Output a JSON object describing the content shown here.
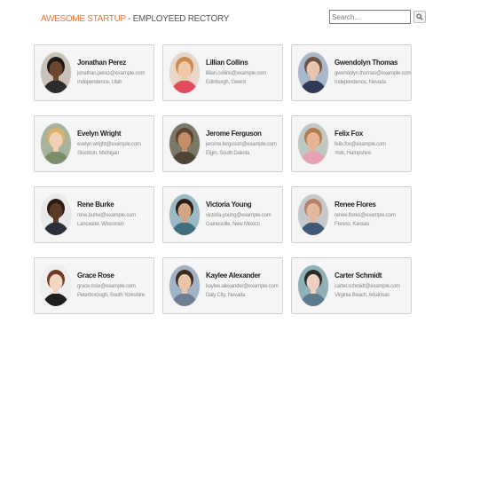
{
  "header": {
    "brand": "AWESOME STARTUP",
    "subtitle": " - EMPLOYEED RECTORY"
  },
  "search": {
    "placeholder": "Search...",
    "button_icon": "search-icon"
  },
  "employees": [
    {
      "name": "Jonathan Perez",
      "email": "jonathan.perez@example.com",
      "location": "Independence, Utah",
      "skin": "#6b4630",
      "hair": "#1f1a16",
      "shirt": "#2b2b2b",
      "bg": "#c9c2b8"
    },
    {
      "name": "Lillian Collins",
      "email": "lillian.collins@example.com",
      "location": "Edinburgh, Gwent",
      "skin": "#f1c9a8",
      "hair": "#c98a4e",
      "shirt": "#e04a5c",
      "bg": "#e8d7c8"
    },
    {
      "name": "Gwendolyn Thomas",
      "email": "gwendolyn.thomas@example.com",
      "location": "Independence, Nevada",
      "skin": "#e9c4ae",
      "hair": "#6b5340",
      "shirt": "#2f3a55",
      "bg": "#a9b7cc"
    },
    {
      "name": "Evelyn Wright",
      "email": "evelyn.wright@example.com",
      "location": "Stockton, Michigan",
      "skin": "#f0cfb4",
      "hair": "#d9b16a",
      "shirt": "#7a8e6a",
      "bg": "#a7b39a"
    },
    {
      "name": "Jerome Ferguson",
      "email": "jerome.ferguson@example.com",
      "location": "Elgin, South Dakota",
      "skin": "#c58c68",
      "hair": "#5a4532",
      "shirt": "#4f4537",
      "bg": "#7c7868"
    },
    {
      "name": "Felix Fox",
      "email": "felix.fox@example.com",
      "location": "York, Hampshire",
      "skin": "#e7b393",
      "hair": "#b07b4c",
      "shirt": "#e6a1b5",
      "bg": "#bfc8c2"
    },
    {
      "name": "Rene Burke",
      "email": "rene.burke@example.com",
      "location": "Lancaster, Wisconsin",
      "skin": "#5a3a26",
      "hair": "#2a1c14",
      "shirt": "#2a2f3a",
      "bg": "#e9e9e9"
    },
    {
      "name": "Victoria Young",
      "email": "victoria.young@example.com",
      "location": "Gainesville, New Mexico",
      "skin": "#d5a587",
      "hair": "#2a1e18",
      "shirt": "#3f6f7c",
      "bg": "#9bb9c4"
    },
    {
      "name": "Renee Flores",
      "email": "renee.flores@example.com",
      "location": "Fresno, Kansas",
      "skin": "#e3b89b",
      "hair": "#b8806a",
      "shirt": "#3e5977",
      "bg": "#c5c9ce"
    },
    {
      "name": "Grace Rose",
      "email": "grace.rose@example.com",
      "location": "Peterborough, South Yorkshire",
      "skin": "#f3d6c4",
      "hair": "#6e3a24",
      "shirt": "#1e1e1e",
      "bg": "#efefef"
    },
    {
      "name": "Kaylee Alexander",
      "email": "kaylee.alexander@example.com",
      "location": "Daly City, Nevada",
      "skin": "#e9c4a6",
      "hair": "#3a2a20",
      "shirt": "#6d7e93",
      "bg": "#9fb3c5"
    },
    {
      "name": "Carter Schmidt",
      "email": "carter.schmidt@example.com",
      "location": "Virginia Beach, Arkansas",
      "skin": "#efd0bf",
      "hair": "#2a2a2a",
      "shirt": "#5b7a8c",
      "bg": "#8fb0b8"
    }
  ]
}
